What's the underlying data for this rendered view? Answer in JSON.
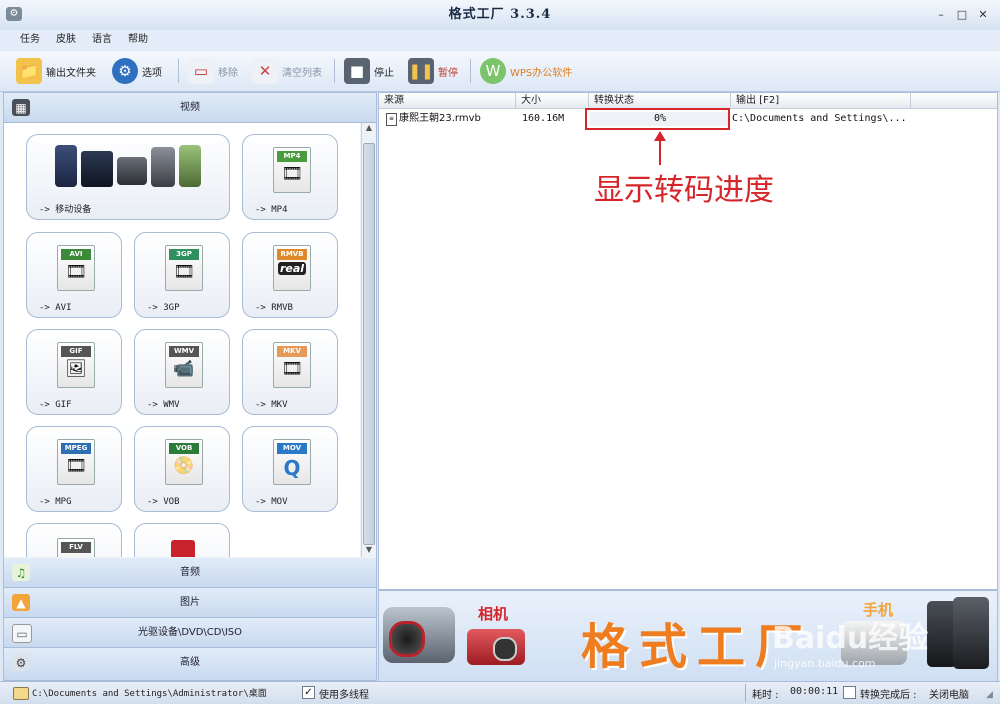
{
  "window": {
    "title": "格式工厂  3.3.4",
    "min_glyph": "–",
    "max_glyph": "□",
    "close_glyph": "✕",
    "app_icon": "app-icon"
  },
  "menu": [
    "任务",
    "皮肤",
    "语言",
    "帮助"
  ],
  "toolbar": {
    "output_folder": "输出文件夹",
    "options": "选项",
    "remove": "移除",
    "clear_list": "清空列表",
    "stop": "停止",
    "pause": "暂停",
    "wps": "WPS办公软件"
  },
  "left": {
    "video_header": "视频",
    "tiles": [
      {
        "caption": "-> 移动设备",
        "icon": "mobile-devices-icon"
      },
      {
        "caption": "-> MP4",
        "tag": "MP4",
        "tag_color": "#4a9b3e",
        "glyph": "🎞"
      },
      {
        "caption": "-> AVI",
        "tag": "AVI",
        "tag_color": "#3a8a3a",
        "glyph": "🎞"
      },
      {
        "caption": "-> 3GP",
        "tag": "3GP",
        "tag_color": "#2f8f5f",
        "glyph": "🎞"
      },
      {
        "caption": "-> RMVB",
        "tag": "RMVB",
        "tag_color": "#e0892a",
        "glyph": "real"
      },
      {
        "caption": "-> GIF",
        "tag": "GIF",
        "tag_color": "#555555",
        "glyph": "🖼"
      },
      {
        "caption": "-> WMV",
        "tag": "WMV",
        "tag_color": "#555555",
        "glyph": "📹"
      },
      {
        "caption": "-> MKV",
        "tag": "MKV",
        "tag_color": "#e59a5a",
        "glyph": "🎞"
      },
      {
        "caption": "-> MPG",
        "tag": "MPEG",
        "tag_color": "#2e6fb2",
        "glyph": "🎞"
      },
      {
        "caption": "-> VOB",
        "tag": "VOB",
        "tag_color": "#2b7b3b",
        "glyph": "📀"
      },
      {
        "caption": "-> MOV",
        "tag": "MOV",
        "tag_color": "#2a79c8",
        "glyph": "Q"
      }
    ],
    "audio_header": "音频",
    "image_header": "图片",
    "disc_header": "光驱设备\\DVD\\CD\\ISO",
    "advanced_header": "高级"
  },
  "table": {
    "headers": [
      "来源",
      "大小",
      "转换状态",
      "输出 [F2]"
    ],
    "rows": [
      {
        "source": "康熙王朝23.rmvb",
        "size": "160.16M",
        "status": "0%",
        "output": "C:\\Documents and Settings\\..."
      }
    ]
  },
  "annotation": {
    "text": "显示转码进度",
    "color": "#d6252a"
  },
  "banner": {
    "camera_label": "相机",
    "brand_text": "格式工厂",
    "phone_label": "手机",
    "watermark_line1": "Baidu经验",
    "watermark_line2": "jingyan.baidu.com"
  },
  "status": {
    "path": "C:\\Documents and Settings\\Administrator\\桌面",
    "multithread_label": "使用多线程",
    "multithread_checked": true,
    "elapsed_label": "耗时 :",
    "elapsed": "00:00:11",
    "after_label": "转换完成后 :",
    "after_value": "关闭电脑"
  }
}
